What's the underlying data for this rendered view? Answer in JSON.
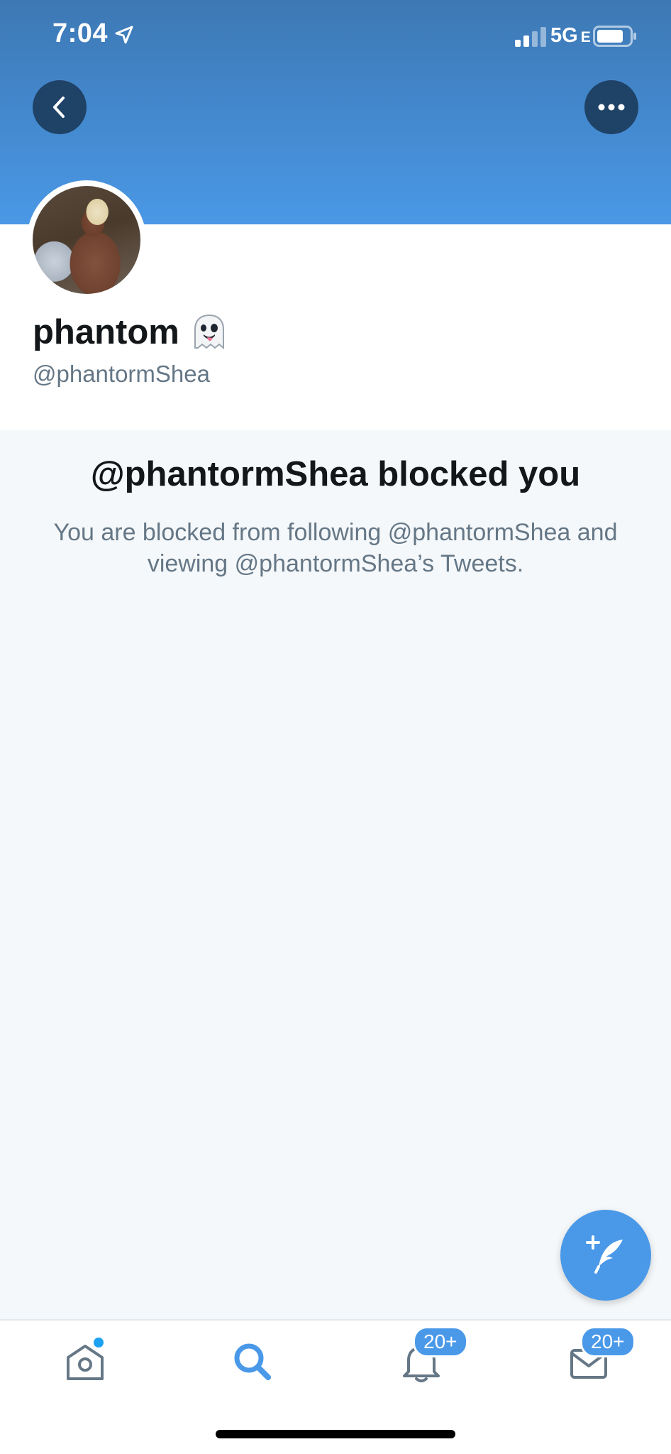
{
  "status_bar": {
    "time": "7:04",
    "network": "5G",
    "network_suffix": "E"
  },
  "header": {
    "back_icon": "chevron-left-icon",
    "more_icon": "ellipsis-icon"
  },
  "profile": {
    "display_name": "phantom",
    "name_emoji": "ghost-emoji",
    "handle": "@phantormShea"
  },
  "blocked": {
    "title": "@phantormShea blocked you",
    "description": "You are blocked from following @phantormShea and viewing @phantormShea’s Tweets."
  },
  "tab_bar": {
    "home_icon": "home-icon",
    "search_icon": "search-icon",
    "notifications_icon": "bell-icon",
    "notifications_badge": "20+",
    "messages_icon": "envelope-icon",
    "messages_badge": "20+"
  },
  "colors": {
    "accent": "#4a99e9",
    "banner_top": "#3d78b4",
    "banner_bottom": "#4a98e6",
    "secondary_text": "#657786"
  }
}
